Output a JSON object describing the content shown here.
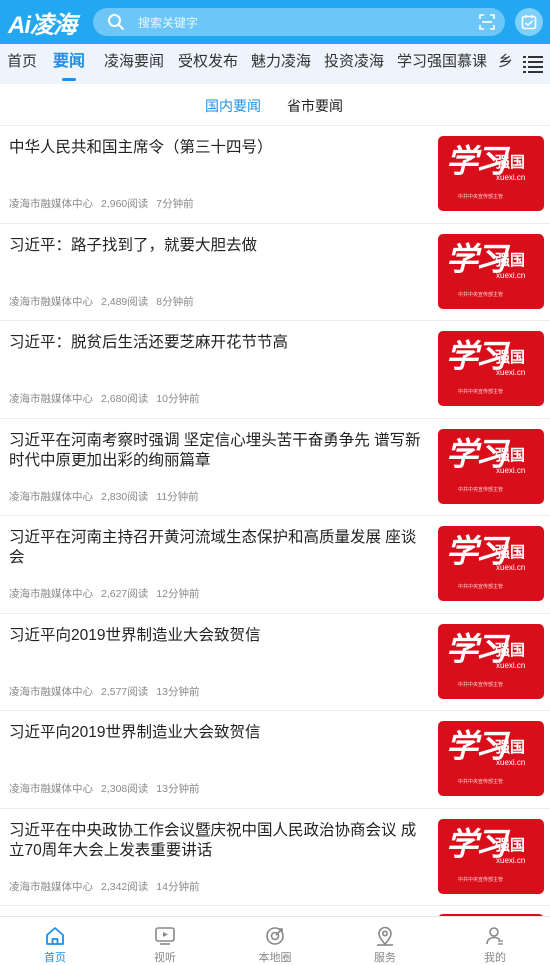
{
  "header": {
    "logo": "Ai凌海",
    "search_placeholder": "搜索关键字",
    "icons": {
      "search": "search-icon",
      "scan": "scan-icon",
      "calendar": "calendar-check-icon"
    },
    "colors": {
      "brand": "#22a7f0",
      "accent": "#1f8fe6"
    }
  },
  "channels": [
    "首页",
    "要闻",
    "凌海要闻",
    "受权发布",
    "魅力凌海",
    "投资凌海",
    "学习强国慕课",
    "乡"
  ],
  "active_channel": "要闻",
  "subtabs": [
    "国内要闻",
    "省市要闻"
  ],
  "active_subtab": "国内要闻",
  "thumbnail": {
    "calligraphy": "学习",
    "brand": "强国",
    "domain": "xuexi.cn",
    "small": "中共中央宣传部主管"
  },
  "news": [
    {
      "title": "中华人民共和国主席令（第三十四号）",
      "source": "凌海市融媒体中心",
      "reads": "2,960阅读",
      "time": "7分钟前"
    },
    {
      "title": "习近平：路子找到了，就要大胆去做",
      "source": "凌海市融媒体中心",
      "reads": "2,489阅读",
      "time": "8分钟前"
    },
    {
      "title": "习近平：脱贫后生活还要芝麻开花节节高",
      "source": "凌海市融媒体中心",
      "reads": "2,680阅读",
      "time": "10分钟前"
    },
    {
      "title": "习近平在河南考察时强调 坚定信心埋头苦干奋勇争先 谱写新时代中原更加出彩的绚丽篇章",
      "source": "凌海市融媒体中心",
      "reads": "2,830阅读",
      "time": "11分钟前"
    },
    {
      "title": "习近平在河南主持召开黄河流域生态保护和高质量发展 座谈会",
      "source": "凌海市融媒体中心",
      "reads": "2,627阅读",
      "time": "12分钟前"
    },
    {
      "title": "习近平向2019世界制造业大会致贺信",
      "source": "凌海市融媒体中心",
      "reads": "2,577阅读",
      "time": "13分钟前"
    },
    {
      "title": "习近平向2019世界制造业大会致贺信",
      "source": "凌海市融媒体中心",
      "reads": "2,308阅读",
      "time": "13分钟前"
    },
    {
      "title": "习近平在中央政协工作会议暨庆祝中国人民政治协商会议 成立70周年大会上发表重要讲话",
      "source": "凌海市融媒体中心",
      "reads": "2,342阅读",
      "time": "14分钟前"
    }
  ],
  "bottom_nav": [
    {
      "label": "首页",
      "icon": "home-icon",
      "active": true
    },
    {
      "label": "视听",
      "icon": "video-icon",
      "active": false
    },
    {
      "label": "本地圈",
      "icon": "target-icon",
      "active": false
    },
    {
      "label": "服务",
      "icon": "location-icon",
      "active": false
    },
    {
      "label": "我的",
      "icon": "user-icon",
      "active": false
    }
  ]
}
